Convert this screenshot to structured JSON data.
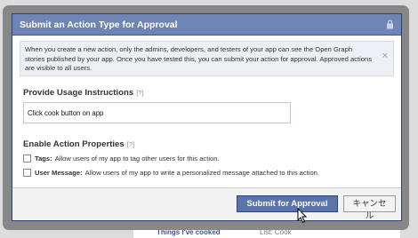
{
  "dialog": {
    "title": "Submit an Action Type for Approval",
    "lock_icon": "lock-icon",
    "notice": "When you create a new action, only the admins, developers, and testers of your app can see the Open Graph stories published by your app. Once you have tested this, you can submit your action for approval. Approved actions are visible to all users.",
    "notice_close": "×",
    "usage": {
      "title": "Provide Usage Instructions",
      "help": "[?]",
      "value": "Click cook button on app"
    },
    "properties": {
      "title": "Enable Action Properties",
      "help": "[?]",
      "items": [
        {
          "name": "Tags:",
          "desc": "Allow users of my app to tag other users for this action.",
          "checked": false
        },
        {
          "name": "User Message:",
          "desc": "Allow users of my app to write a personalized message attached to this action.",
          "checked": false
        }
      ]
    },
    "buttons": {
      "submit": "Submit for Approval",
      "cancel": "キャンセル"
    }
  },
  "background": {
    "link": "Things I've cooked",
    "meta": "List: Cook"
  }
}
